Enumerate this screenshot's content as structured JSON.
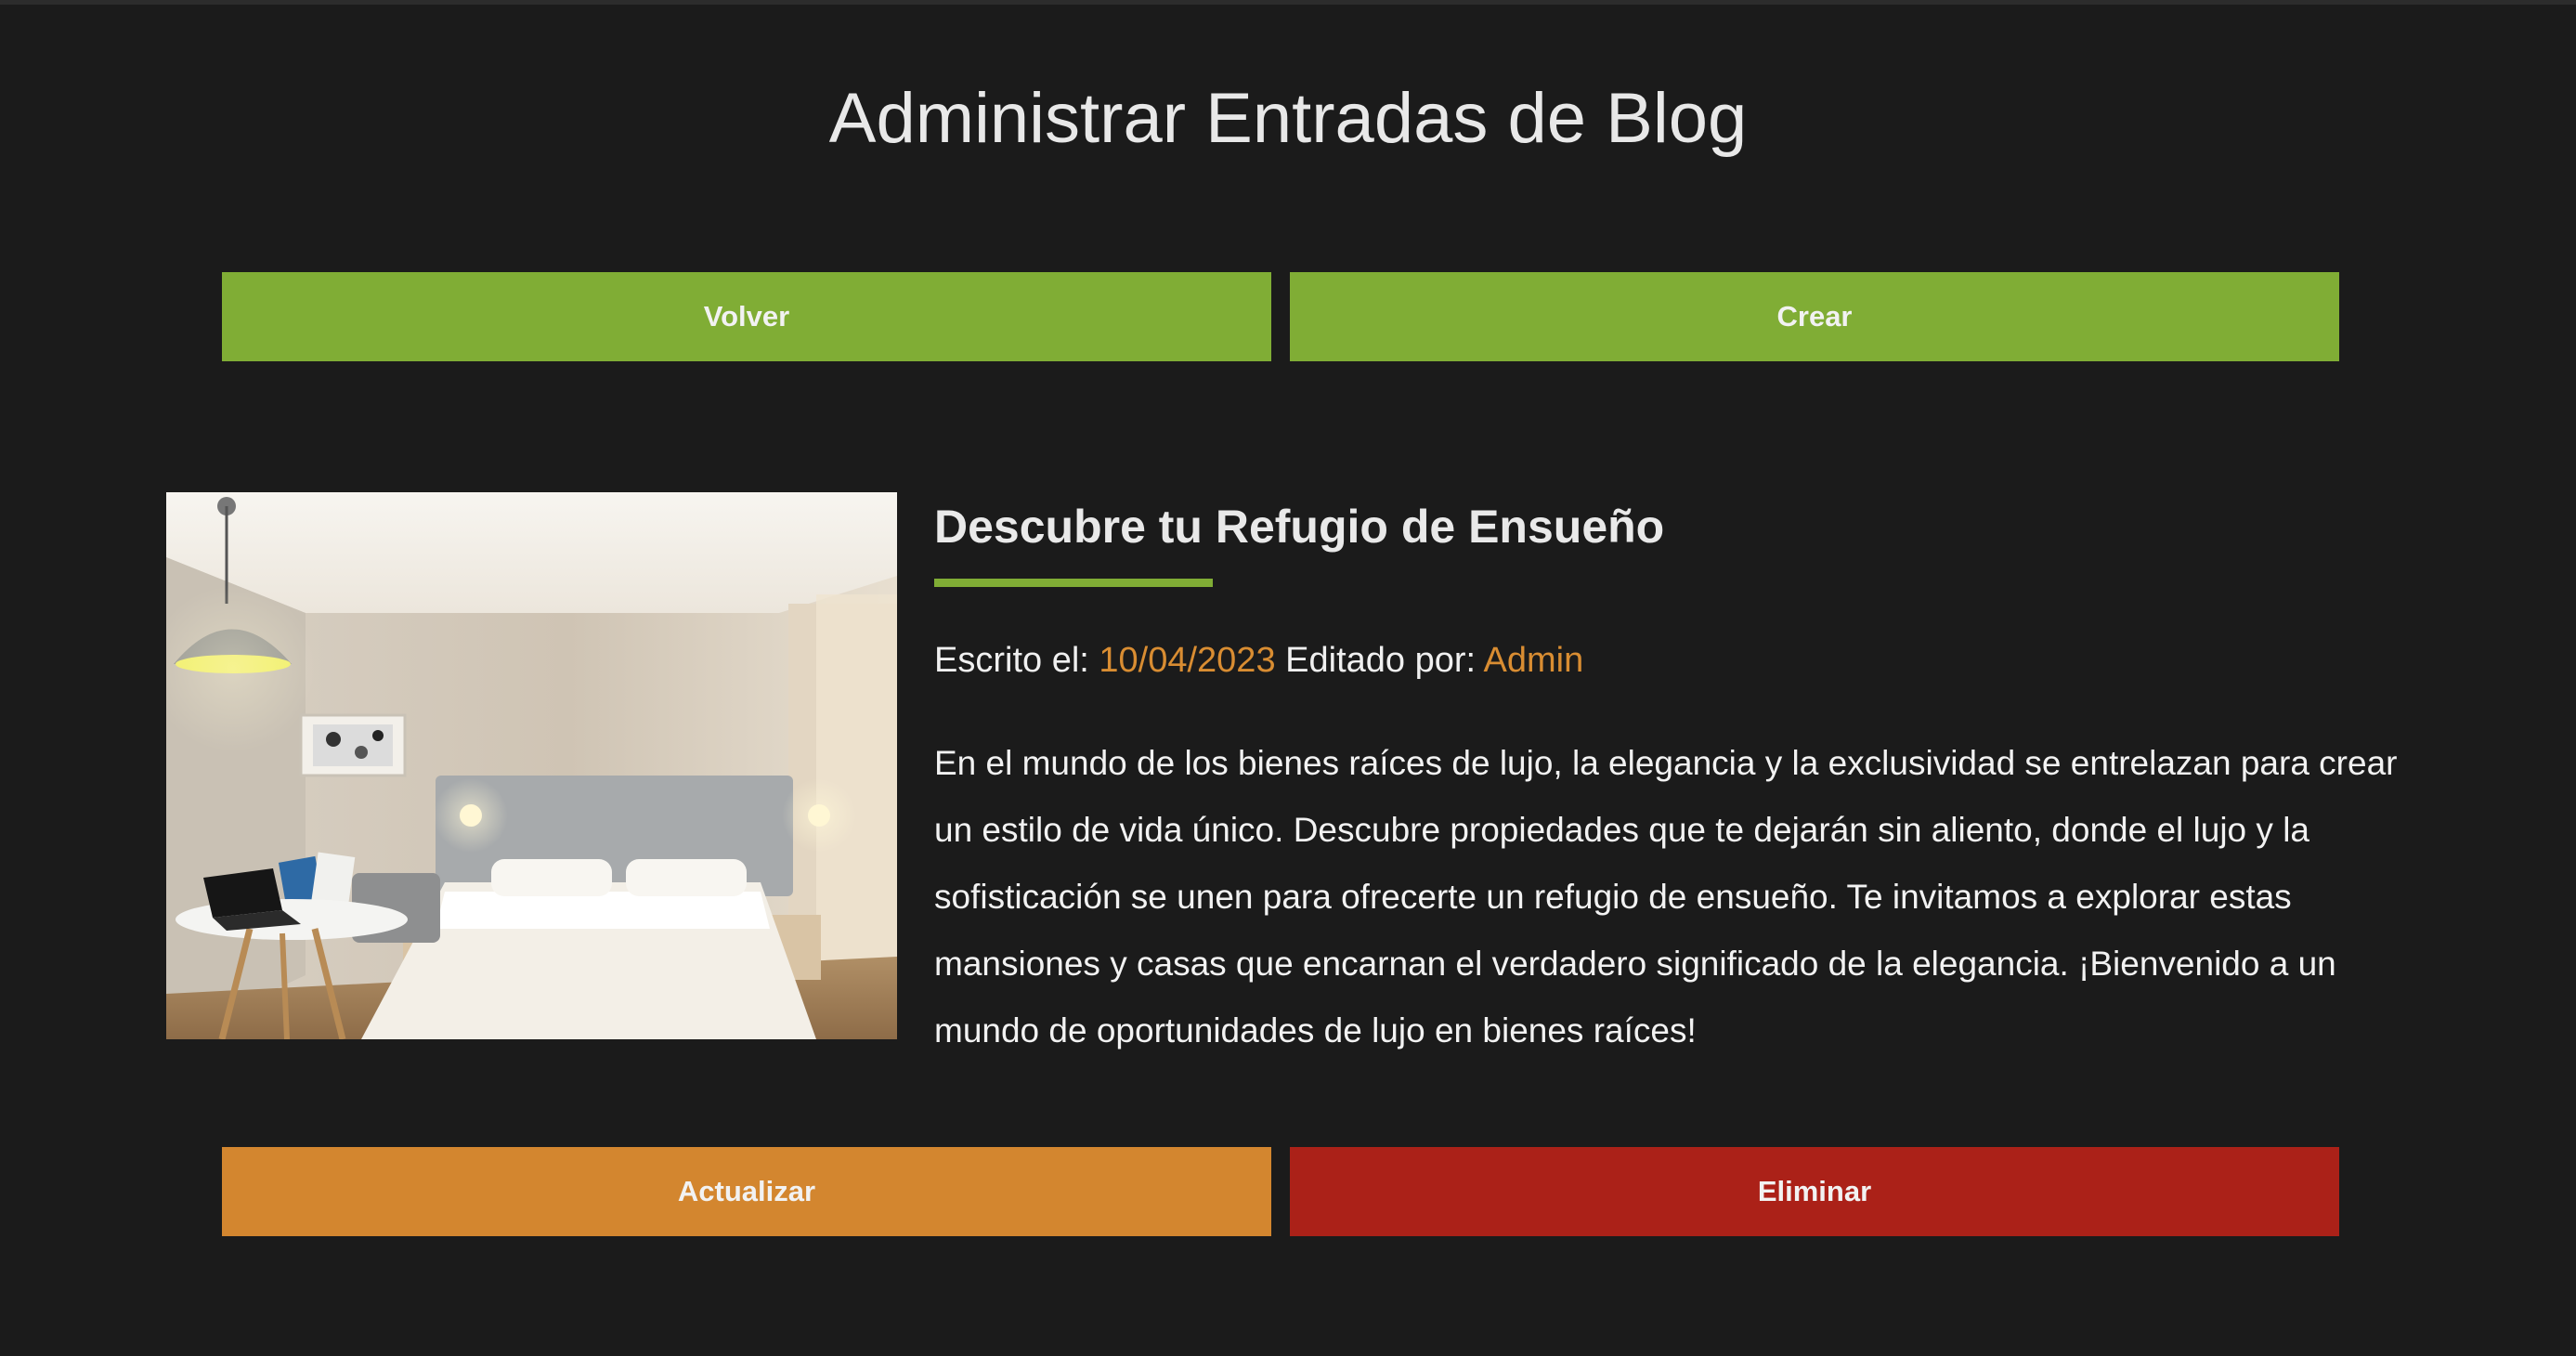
{
  "page": {
    "title": "Administrar Entradas de Blog"
  },
  "actions": {
    "back_label": "Volver",
    "create_label": "Crear"
  },
  "entry": {
    "title": "Descubre tu Refugio de Ensueño",
    "written_label": "Escrito el:",
    "date": "10/04/2023",
    "edited_label": "Editado por:",
    "author": "Admin",
    "excerpt": "En el mundo de los bienes raíces de lujo, la elegancia y la exclusividad se entrelazan para crear un estilo de vida único. Descubre propiedades que te dejarán sin aliento, donde el lujo y la sofisticación se unen para ofrecerte un refugio de ensueño. Te invitamos a explorar estas mansiones y casas que encarnan el verdadero significado de la elegancia. ¡Bienvenido a un mundo de oportunidades de lujo en bienes raíces!",
    "image": "bedroom-photo",
    "update_label": "Actualizar",
    "delete_label": "Eliminar"
  },
  "colors": {
    "background": "#1b1b1b",
    "primary_green": "#80ad35",
    "accent_orange": "#d3862f",
    "danger_red": "#ab2118",
    "text": "#f2f2f2"
  }
}
